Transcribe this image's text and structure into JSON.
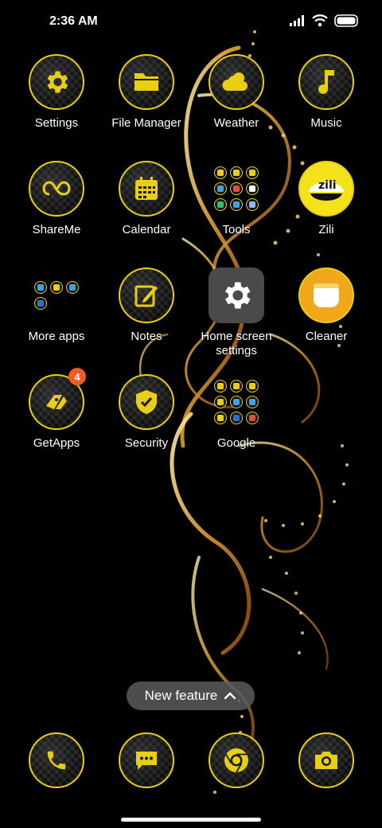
{
  "status_bar": {
    "time": "2:36 AM",
    "icons": [
      "signal-icon",
      "wifi-icon",
      "battery-icon"
    ]
  },
  "apps": [
    {
      "label": "Settings",
      "icon": "gear-icon"
    },
    {
      "label": "File Manager",
      "icon": "folder-icon"
    },
    {
      "label": "Weather",
      "icon": "cloud-sun-icon"
    },
    {
      "label": "Music",
      "icon": "music-note-icon"
    },
    {
      "label": "ShareMe",
      "icon": "infinity-icon"
    },
    {
      "label": "Calendar",
      "icon": "calendar-icon"
    },
    {
      "label": "Tools",
      "icon": "folder-grid-icon"
    },
    {
      "label": "Zili",
      "icon": "zili-icon"
    },
    {
      "label": "More apps",
      "icon": "folder-grid-icon"
    },
    {
      "label": "Notes",
      "icon": "pencil-note-icon"
    },
    {
      "label": "Home screen settings",
      "icon": "gear-icon"
    },
    {
      "label": "Cleaner",
      "icon": "cleaner-icon"
    },
    {
      "label": "GetApps",
      "icon": "shopping-bag-icon",
      "badge": "4"
    },
    {
      "label": "Security",
      "icon": "shield-check-icon"
    },
    {
      "label": "Google",
      "icon": "folder-grid-icon"
    }
  ],
  "new_feature": {
    "label": "New feature"
  },
  "dock": [
    {
      "icon": "phone-icon"
    },
    {
      "icon": "message-icon"
    },
    {
      "icon": "chrome-icon"
    },
    {
      "icon": "camera-icon"
    }
  ],
  "colors": {
    "accent": "#e9cf12",
    "badge": "#f15a24",
    "gold": "#d9a441"
  }
}
